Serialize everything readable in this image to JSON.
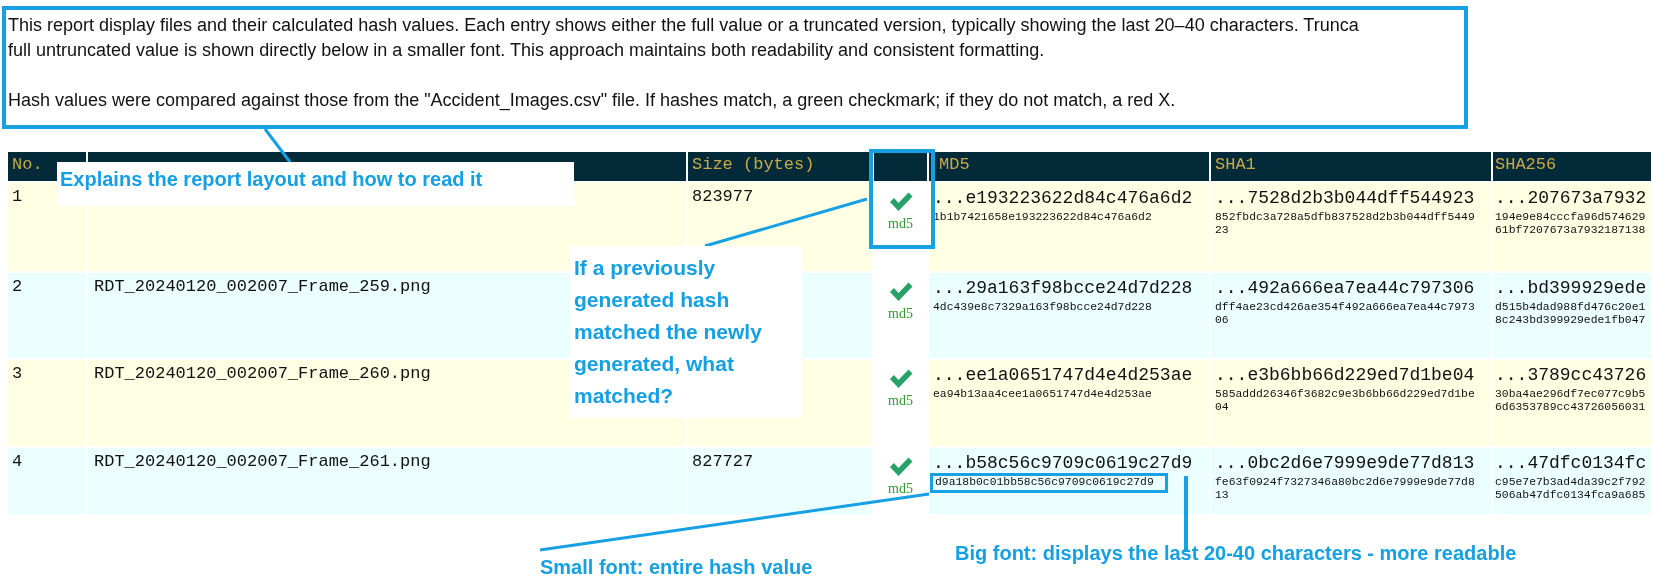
{
  "description": {
    "paragraphs": [
      {
        "lines": [
          "This report display files and their calculated hash values. Each entry shows either the full value or a truncated version, typically showing the last 20–40 characters. Trunca",
          "full untruncated value is shown directly below in a smaller font. This approach maintains both readability and consistent formatting."
        ]
      },
      {
        "lines": [
          "Hash values were compared against those from the \"Accident_Images.csv\" file. If hashes match, a green checkmark; if they do not match, a red X."
        ]
      }
    ]
  },
  "table": {
    "columns": [
      {
        "label": "No."
      },
      {},
      {
        "label": "Size (bytes)"
      },
      {},
      {
        "label": "MD5"
      },
      {
        "label": "SHA1"
      },
      {
        "label": "SHA256"
      }
    ],
    "rows": [
      {
        "no": "1",
        "size": "823977",
        "match": {
          "matched": true,
          "label": "md5"
        },
        "hashes": [
          {
            "short": "...e193223622d84c476a6d2",
            "full_lines": [
              "1b1b7421658e193223622d84c476a6d2"
            ]
          },
          {
            "short": "...7528d2b3b044dff544923",
            "full_lines": [
              "852fbdc3a728a5dfb837528d2b3b044dff5449",
              "23"
            ]
          },
          {
            "short": "...207673a7932",
            "full_lines": [
              "194e9e84cccfa96d574629",
              "61bf7207673a7932187138"
            ]
          }
        ]
      },
      {
        "no": "2",
        "file_name": "RDT_20240120_002007_Frame_259.png",
        "match": {
          "matched": true,
          "label": "md5"
        },
        "hashes": [
          {
            "short": "...29a163f98bcce24d7d228",
            "full_lines": [
              "4dc439e8c7329a163f98bcce24d7d228"
            ]
          },
          {
            "short": "...492a666ea7ea44c797306",
            "full_lines": [
              "dff4ae23cd426ae354f492a666ea7ea44c7973",
              "06"
            ]
          },
          {
            "short": "...bd399929ede",
            "full_lines": [
              "d515b4dad988fd476c20e1",
              "8c243bd399929ede1fb047"
            ]
          }
        ]
      },
      {
        "no": "3",
        "file_name": "RDT_20240120_002007_Frame_260.png",
        "match": {
          "matched": true,
          "label": "md5"
        },
        "hashes": [
          {
            "short": "...ee1a0651747d4e4d253ae",
            "full_lines": [
              "ea94b13aa4cee1a0651747d4e4d253ae"
            ]
          },
          {
            "short": "...e3b6bb66d229ed7d1be04",
            "full_lines": [
              "585addd26346f3682c9e3b6bb66d229ed7d1be",
              "04"
            ]
          },
          {
            "short": "...3789cc43726",
            "full_lines": [
              "30ba4ae296df7ec077c9b5",
              "6d6353789cc43726056031"
            ]
          }
        ]
      },
      {
        "no": "4",
        "file_name": "RDT_20240120_002007_Frame_261.png",
        "size": "827727",
        "match": {
          "matched": true,
          "label": "md5"
        },
        "hashes": [
          {
            "short": "...b58c56c9709c0619c27d9",
            "full_lines": [
              "d9a18b0c01bb58c56c9709c0619c27d9"
            ]
          },
          {
            "short": "...0bc2d6e7999e9de77d813",
            "full_lines": [
              "fe63f0924f7327346a80bc2d6e7999e9de77d8",
              "13"
            ]
          },
          {
            "short": "...47dfc0134fc",
            "full_lines": [
              "c95e7e7b3ad4da39c2f792",
              "506ab47dfc0134fca9a685"
            ]
          }
        ]
      }
    ]
  },
  "annotations": [
    {
      "text": "Explains the report layout and how to read it"
    },
    {
      "text": "If a previously generated hash matched the newly generated, what matched?"
    },
    {
      "text": "Small font: entire hash value"
    },
    {
      "text": "Big font: displays the last 20-40 characters - more readable"
    }
  ]
}
